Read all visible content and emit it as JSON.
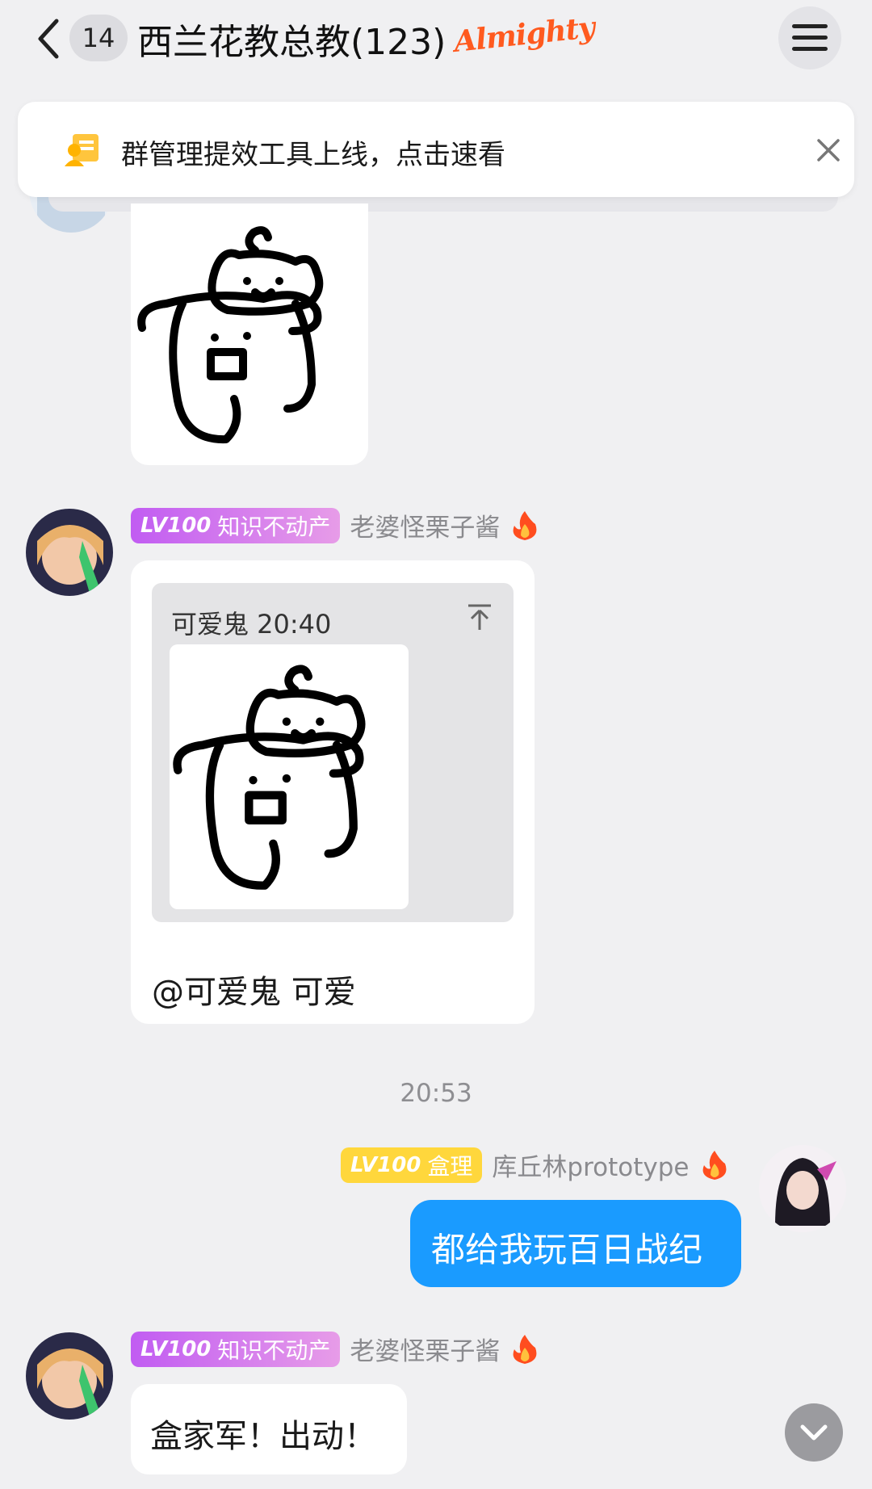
{
  "header": {
    "unread_count": "14",
    "title": "西兰花教总教(123)",
    "title_badge": "Almighty"
  },
  "notice": {
    "text": "群管理提效工具上线，点击速看"
  },
  "messages": [
    {
      "level": "LV100",
      "title_badge": "知识不动产",
      "sender": "老婆怪栗子酱",
      "quote_meta": "可爱鬼 20:40",
      "text": "@可爱鬼 可爱"
    },
    {
      "time_divider": "20:53"
    },
    {
      "level": "LV100",
      "title_badge": "盒理",
      "sender": "库丘林prototype",
      "text": "都给我玩百日战纪"
    },
    {
      "level": "LV100",
      "title_badge": "知识不动产",
      "sender": "老婆怪栗子酱",
      "text": "盒家军！出动！"
    }
  ],
  "colors": {
    "accent_blue": "#1a9bff",
    "badge_purple": "#c15cf2",
    "badge_yellow": "#ffd73c",
    "almighty_orange": "#ff5a1f"
  },
  "icons": [
    "back-chevron-icon",
    "menu-icon",
    "notice-doc-icon",
    "close-icon",
    "fire-icon",
    "pin-top-icon",
    "chevron-down-icon"
  ]
}
